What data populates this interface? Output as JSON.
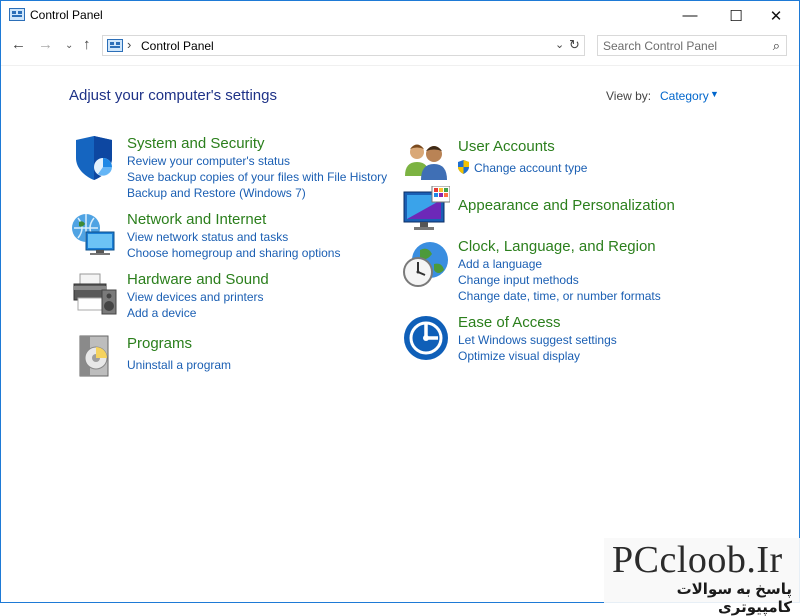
{
  "window": {
    "title": "Control Panel",
    "minimize_glyph": "—",
    "maximize_glyph": "☐",
    "close_glyph": "✕"
  },
  "nav": {
    "back_glyph": "←",
    "forward_glyph": "→",
    "recent_glyph": "⌄",
    "up_glyph": "↑"
  },
  "address": {
    "separator": "›",
    "path": "Control Panel",
    "dropdown_glyph": "⌄",
    "refresh_glyph": "↻"
  },
  "search": {
    "placeholder": "Search Control Panel",
    "icon_glyph": "⌕"
  },
  "main": {
    "title": "Adjust your computer's settings",
    "view_by_label": "View by:",
    "view_by_value": "Category",
    "view_by_caret": "▼"
  },
  "categories": {
    "system_security": {
      "title": "System and Security",
      "links": [
        "Review your computer's status",
        "Save backup copies of your files with File History",
        "Backup and Restore (Windows 7)"
      ]
    },
    "network": {
      "title": "Network and Internet",
      "links": [
        "View network status and tasks",
        "Choose homegroup and sharing options"
      ]
    },
    "hardware": {
      "title": "Hardware and Sound",
      "links": [
        "View devices and printers",
        "Add a device"
      ]
    },
    "programs": {
      "title": "Programs",
      "links": [
        "Uninstall a program"
      ]
    },
    "user_accounts": {
      "title": "User Accounts",
      "links": [
        "Change account type"
      ]
    },
    "appearance": {
      "title": "Appearance and Personalization",
      "links": []
    },
    "clock": {
      "title": "Clock, Language, and Region",
      "links": [
        "Add a language",
        "Change input methods",
        "Change date, time, or number formats"
      ]
    },
    "ease": {
      "title": "Ease of Access",
      "links": [
        "Let Windows suggest settings",
        "Optimize visual display"
      ]
    }
  },
  "watermark": {
    "title": "PCcloob.Ir",
    "subtitle": "پاسخ به سوالات کامپیوتری"
  },
  "colors": {
    "category_title": "#2b7f1c",
    "link": "#1b5fb3",
    "page_title": "#1e3287",
    "window_border": "#1e7ad6"
  }
}
